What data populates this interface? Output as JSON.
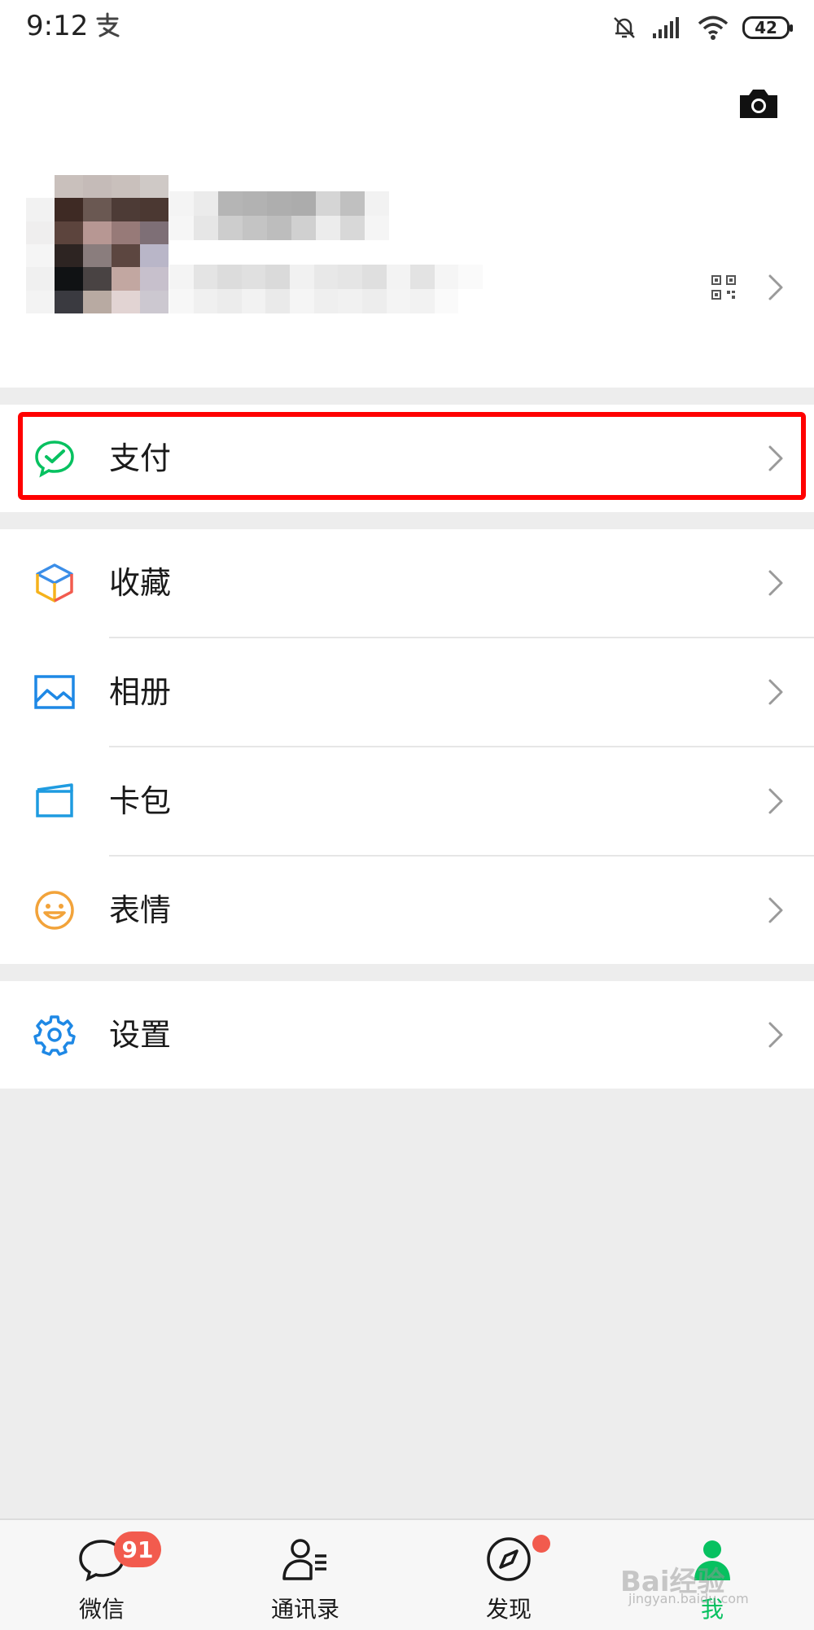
{
  "status_bar": {
    "time": "9:12",
    "battery": "42"
  },
  "menu": {
    "pay": "支付",
    "favorites": "收藏",
    "album": "相册",
    "card_wallet": "卡包",
    "stickers": "表情",
    "settings": "设置"
  },
  "tabs": {
    "chats": {
      "label": "微信",
      "badge": "91"
    },
    "contacts": {
      "label": "通讯录"
    },
    "discover": {
      "label": "发现"
    },
    "me": {
      "label": "我"
    }
  },
  "colors": {
    "accent_green": "#07c160",
    "badge_red": "#f25b4e",
    "highlight_red": "#ff0000",
    "icon_blue": "#1e88e5",
    "emoji_orange": "#f2a33a"
  },
  "icons": {
    "status": [
      "alipay-icon",
      "bell-off-icon",
      "signal-icon",
      "wifi-icon",
      "battery-icon"
    ],
    "profile": [
      "camera-icon",
      "qr-code-icon",
      "chevron-right-icon"
    ],
    "rows": [
      "wechat-pay-icon",
      "cube-icon",
      "image-icon",
      "card-icon",
      "smile-icon",
      "gear-icon"
    ],
    "tabs": [
      "chat-bubble-icon",
      "contacts-icon",
      "compass-icon",
      "person-icon"
    ]
  },
  "watermark": {
    "main": "Bai经验",
    "sub": "jingyan.baidu.com"
  }
}
